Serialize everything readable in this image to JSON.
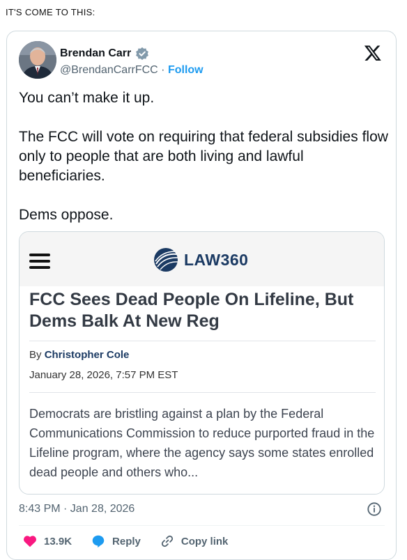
{
  "caption": "IT'S COME TO THIS:",
  "tweet": {
    "author_name": "Brendan Carr",
    "handle": "@BrendanCarrFCC",
    "separator": " · ",
    "follow_label": "Follow",
    "body": [
      "You can’t make it up.",
      "The FCC will vote on requiring that federal subsidies flow only to people that are both living and lawful beneficiaries.",
      "Dems oppose."
    ],
    "timestamp": "8:43 PM · Jan 28, 2026",
    "likes_count": "13.9K",
    "reply_label": "Reply",
    "copy_link_label": "Copy link"
  },
  "card": {
    "site_name": "LAW360",
    "headline": "FCC Sees Dead People On Lifeline, But Dems Balk At New Reg",
    "byline_prefix": "By ",
    "author": "Christopher Cole",
    "date": "January 28, 2026, 7:57 PM EST",
    "summary": "Democrats are bristling against a plan by the Federal Communications Commission to reduce purported fraud in the Lifeline program, where the agency says some states enrolled dead people and others who..."
  },
  "colors": {
    "link_blue": "#1d9bf0",
    "heart_pink": "#f91880",
    "law360_navy": "#1b3a63",
    "muted_gray": "#536471"
  },
  "icons": [
    "verified-badge-icon",
    "x-logo-icon",
    "hamburger-menu-icon",
    "law360-logo-icon",
    "info-icon",
    "heart-icon",
    "reply-icon",
    "link-icon"
  ]
}
